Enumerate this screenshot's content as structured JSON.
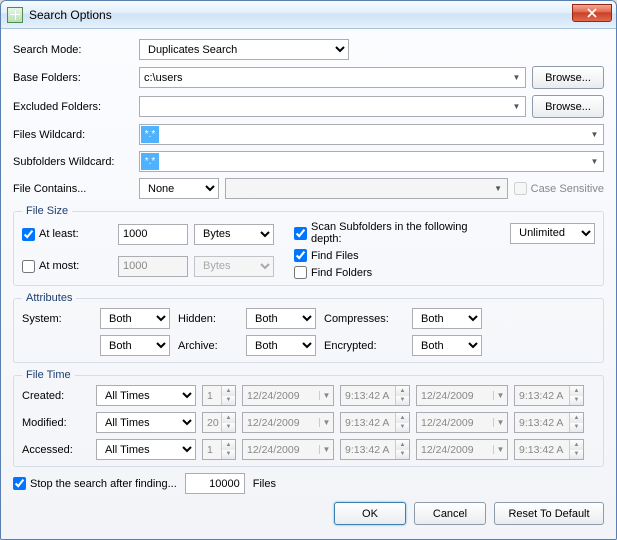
{
  "window": {
    "title": "Search Options"
  },
  "labels": {
    "search_mode": "Search Mode:",
    "base_folders": "Base Folders:",
    "excluded_folders": "Excluded Folders:",
    "files_wildcard": "Files Wildcard:",
    "subfolders_wildcard": "Subfolders Wildcard:",
    "file_contains": "File Contains...",
    "case_sensitive": "Case Sensitive",
    "file_size_legend": "File Size",
    "at_least": "At least:",
    "at_most": "At most:",
    "scan_subfolders": "Scan Subfolders in the following depth:",
    "find_files": "Find Files",
    "find_folders": "Find Folders",
    "attributes_legend": "Attributes",
    "system": "System:",
    "hidden": "Hidden:",
    "compresses": "Compresses:",
    "read_only_blank": "",
    "archive": "Archive:",
    "encrypted": "Encrypted:",
    "file_time_legend": "File Time",
    "created": "Created:",
    "modified": "Modified:",
    "accessed": "Accessed:",
    "stop_search": "Stop the search after finding...",
    "files_word": "Files",
    "browse": "Browse...",
    "ok": "OK",
    "cancel": "Cancel",
    "reset": "Reset To Default"
  },
  "values": {
    "search_mode": "Duplicates Search",
    "base_folders": "c:\\users",
    "excluded_folders": "",
    "files_wildcard": "*.*",
    "subfolders_wildcard": "*.*",
    "file_contains_mode": "None",
    "file_contains_text": "",
    "case_sensitive_checked": false,
    "at_least_checked": true,
    "at_least_value": "1000",
    "at_least_unit": "Bytes",
    "at_most_checked": false,
    "at_most_value": "1000",
    "at_most_unit": "Bytes",
    "scan_subfolders_checked": true,
    "find_files_checked": true,
    "find_folders_checked": false,
    "depth": "Unlimited",
    "attr_system": "Both",
    "attr_hidden": "Both",
    "attr_compresses": "Both",
    "attr_readonly": "Both",
    "attr_archive": "Both",
    "attr_encrypted": "Both",
    "time_mode": "All Times",
    "created_count": "1",
    "modified_count": "20",
    "accessed_count": "1",
    "date1": "12/24/2009",
    "time1": "9:13:42 A",
    "date2": "12/24/2009",
    "time2": "9:13:42 A",
    "stop_checked": true,
    "stop_count": "10000"
  }
}
